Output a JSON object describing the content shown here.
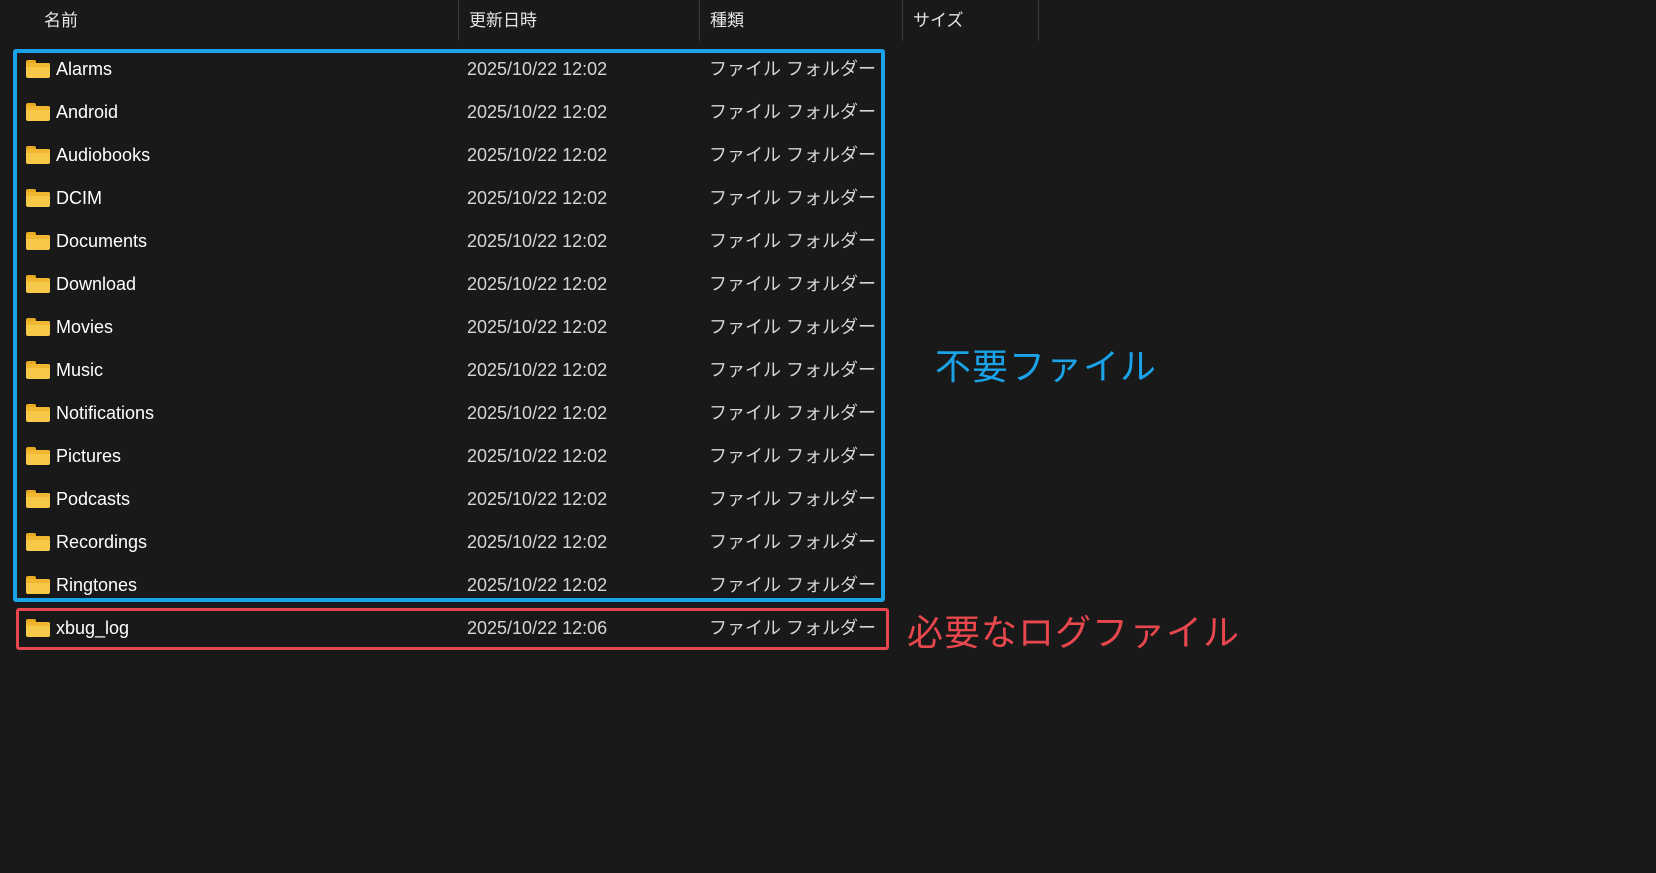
{
  "header": {
    "columns": [
      {
        "label": "名前"
      },
      {
        "label": "更新日時"
      },
      {
        "label": "種類"
      },
      {
        "label": "サイズ"
      }
    ]
  },
  "rows": [
    {
      "name": "Alarms",
      "date": "2025/10/22 12:02",
      "type": "ファイル フォルダー"
    },
    {
      "name": "Android",
      "date": "2025/10/22 12:02",
      "type": "ファイル フォルダー"
    },
    {
      "name": "Audiobooks",
      "date": "2025/10/22 12:02",
      "type": "ファイル フォルダー"
    },
    {
      "name": "DCIM",
      "date": "2025/10/22 12:02",
      "type": "ファイル フォルダー"
    },
    {
      "name": "Documents",
      "date": "2025/10/22 12:02",
      "type": "ファイル フォルダー"
    },
    {
      "name": "Download",
      "date": "2025/10/22 12:02",
      "type": "ファイル フォルダー"
    },
    {
      "name": "Movies",
      "date": "2025/10/22 12:02",
      "type": "ファイル フォルダー"
    },
    {
      "name": "Music",
      "date": "2025/10/22 12:02",
      "type": "ファイル フォルダー"
    },
    {
      "name": "Notifications",
      "date": "2025/10/22 12:02",
      "type": "ファイル フォルダー"
    },
    {
      "name": "Pictures",
      "date": "2025/10/22 12:02",
      "type": "ファイル フォルダー"
    },
    {
      "name": "Podcasts",
      "date": "2025/10/22 12:02",
      "type": "ファイル フォルダー"
    },
    {
      "name": "Recordings",
      "date": "2025/10/22 12:02",
      "type": "ファイル フォルダー"
    },
    {
      "name": "Ringtones",
      "date": "2025/10/22 12:02",
      "type": "ファイル フォルダー"
    },
    {
      "name": "xbug_log",
      "date": "2025/10/22 12:06",
      "type": "ファイル フォルダー"
    }
  ],
  "annotations": {
    "unneeded_label": "不要ファイル",
    "needed_label": "必要なログファイル",
    "unneeded_color": "#1aa3e8",
    "needed_color": "#e8474d"
  },
  "icons": {
    "folder": "folder-icon",
    "sort": "sort-up-caret-icon"
  }
}
